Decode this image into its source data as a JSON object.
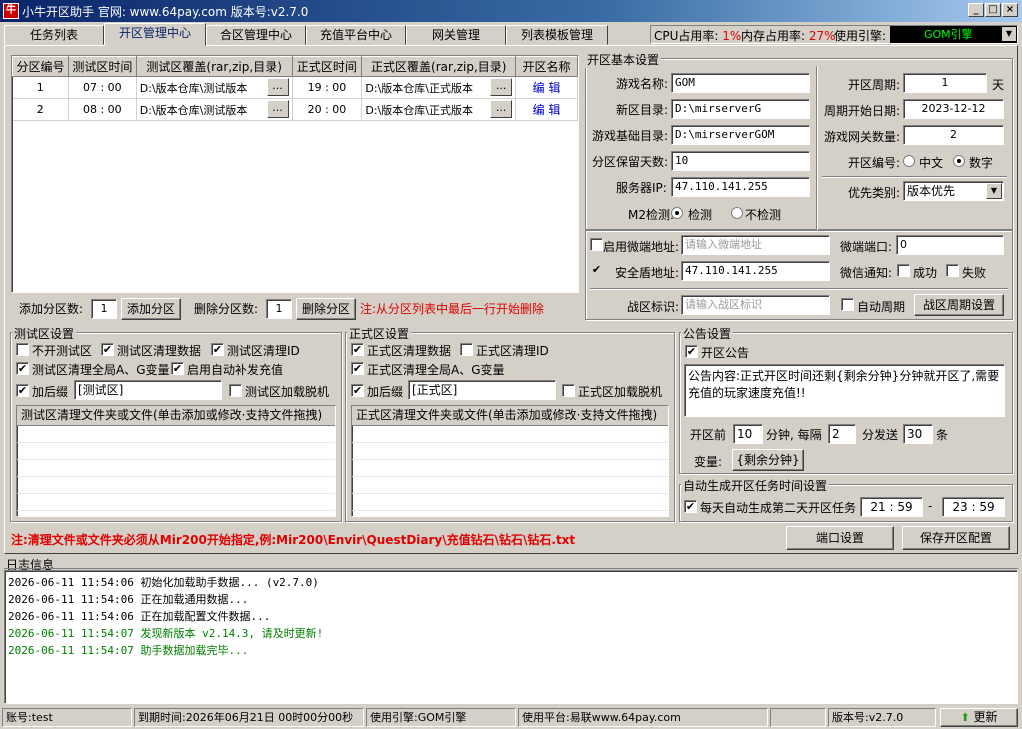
{
  "window": {
    "title": "小牛开区助手 官网: www.64pay.com 版本号:v2.7.0",
    "app_icon_text": "牛"
  },
  "tabs": [
    "任务列表",
    "开区管理中心",
    "合区管理中心",
    "充值平台中心",
    "网关管理",
    "列表模板管理"
  ],
  "active_tab": "开区管理中心",
  "sysinfo": {
    "cpu_label": "CPU占用率:",
    "cpu_value": "1%",
    "mem_label": "内存占用率:",
    "mem_value": "27%",
    "engine_label": "使用引擎:",
    "engine_value": "GOM引擎"
  },
  "zone_table": {
    "headers": [
      "分区编号",
      "测试区时间",
      "测试区覆盖(rar,zip,目录)",
      "正式区时间",
      "正式区覆盖(rar,zip,目录)",
      "开区名称"
    ],
    "browse_label": "...",
    "rows": [
      {
        "id": "1",
        "test_time": "07 : 00",
        "test_path": "D:\\版本仓库\\测试版本",
        "formal_time": "19 : 00",
        "formal_path": "D:\\版本仓库\\正式版本",
        "action": "编  辑"
      },
      {
        "id": "2",
        "test_time": "08 : 00",
        "test_path": "D:\\版本仓库\\测试版本",
        "formal_time": "20 : 00",
        "formal_path": "D:\\版本仓库\\正式版本",
        "action": "编  辑"
      }
    ]
  },
  "zone_ops": {
    "add_label": "添加分区数:",
    "add_value": "1",
    "add_button": "添加分区",
    "del_label": "删除分区数:",
    "del_value": "1",
    "del_button": "删除分区",
    "note": "注:从分区列表中最后一行开始删除"
  },
  "basic": {
    "group_title": "开区基本设置",
    "game_name_label": "游戏名称:",
    "game_name": "GOM",
    "new_dir_label": "新区目录:",
    "new_dir": "D:\\mirserverG",
    "base_dir_label": "游戏基础目录:",
    "base_dir": "D:\\mirserverGOM",
    "keep_days_label": "分区保留天数:",
    "keep_days": "10",
    "server_ip_label": "服务器IP:",
    "server_ip": "47.110.141.255",
    "m2_label": "M2检测:",
    "m2_on": "检测",
    "m2_off": "不检测",
    "cycle_label": "开区周期:",
    "cycle_value": "1",
    "cycle_unit": "天",
    "cycle_start_label": "周期开始日期:",
    "cycle_start": "2023-12-12",
    "gateway_label": "游戏网关数量:",
    "gateway_value": "2",
    "numbering_label": "开区编号:",
    "numbering_cn": "中文",
    "numbering_num": "数字",
    "priority_label": "优先类别:",
    "priority_value": "版本优先"
  },
  "wechat": {
    "enable_label": "启用微端地址:",
    "addr_placeholder": "请输入微端地址",
    "port_label": "微端端口:",
    "port_value": "0",
    "shield_label": "安全盾地址:",
    "shield_value": "47.110.141.255",
    "notify_label": "微信通知:",
    "notify_ok": "成功",
    "notify_fail": "失败",
    "battle_label": "战区标识:",
    "battle_placeholder": "请输入战区标识",
    "auto_cycle_label": "自动周期",
    "cycle_button": "战区周期设置"
  },
  "test_zone": {
    "group_title": "测试区设置",
    "no_test": "不开测试区",
    "clear_data": "测试区清理数据",
    "clear_id": "测试区清理ID",
    "clear_vars": "测试区清理全局A、G变量",
    "auto_recharge": "启用自动补发充值",
    "suffix_label": "加后缀",
    "suffix_value": "[测试区]",
    "offline_load": "测试区加载脱机",
    "list_header": "测试区清理文件夹或文件(单击添加或修改·支持文件拖拽)"
  },
  "formal_zone": {
    "group_title": "正式区设置",
    "clear_data": "正式区清理数据",
    "clear_id": "正式区清理ID",
    "clear_vars": "正式区清理全局A、G变量",
    "suffix_label": "加后缀",
    "suffix_value": "[正式区]",
    "offline_load": "正式区加载脱机",
    "list_header": "正式区清理文件夹或文件(单击添加或修改·支持文件拖拽)"
  },
  "announce": {
    "group_title": "公告设置",
    "enable_label": "开区公告",
    "content": "公告内容:正式开区时间还剩{剩余分钟}分钟就开区了,需要充值的玩家速度充值!!",
    "before_label": "开区前",
    "before_value": "10",
    "minute_every": "分钟, 每隔",
    "interval_value": "2",
    "send_label": "分发送",
    "count_value": "30",
    "count_unit": "条",
    "var_label": "变量:",
    "var_button": "{剩余分钟}"
  },
  "auto_task": {
    "group_title": "自动生成开区任务时间设置",
    "label": "每天自动生成第二天开区任务",
    "start": "21 : 59",
    "dash": "-",
    "end": "23 : 59"
  },
  "bottom": {
    "note": "注:清理文件或文件夹必须从Mir200开始指定,例:Mir200\\Envir\\QuestDiary\\充值钻石\\钻石\\钻石.txt",
    "port_button": "端口设置",
    "save_button": "保存开区配置"
  },
  "log": {
    "title": "日志信息",
    "lines": [
      {
        "text": "2026-06-11 11:54:06 初始化加载助手数据... (v2.7.0)",
        "color": "#000000"
      },
      {
        "text": "2026-06-11 11:54:06 正在加载通用数据...",
        "color": "#000000"
      },
      {
        "text": "2026-06-11 11:54:06 正在加载配置文件数据...",
        "color": "#000000"
      },
      {
        "text": "2026-06-11 11:54:07 发现新版本 v2.14.3, 请及时更新!",
        "color": "#008000"
      },
      {
        "text": "2026-06-11 11:54:07 助手数据加载完毕...",
        "color": "#008000"
      }
    ]
  },
  "statusbar": {
    "account": "账号:test",
    "expire": "到期时间:2026年06月21日 00时00分00秒",
    "engine": "使用引擎:GOM引擎",
    "platform": "使用平台:易联www.64pay.com",
    "version": "版本号:v2.7.0",
    "update": "更新"
  },
  "colors": {
    "accent": "#0a246a",
    "note_red": "#e00000",
    "log_green": "#008000",
    "engine_green": "#00ff00"
  }
}
